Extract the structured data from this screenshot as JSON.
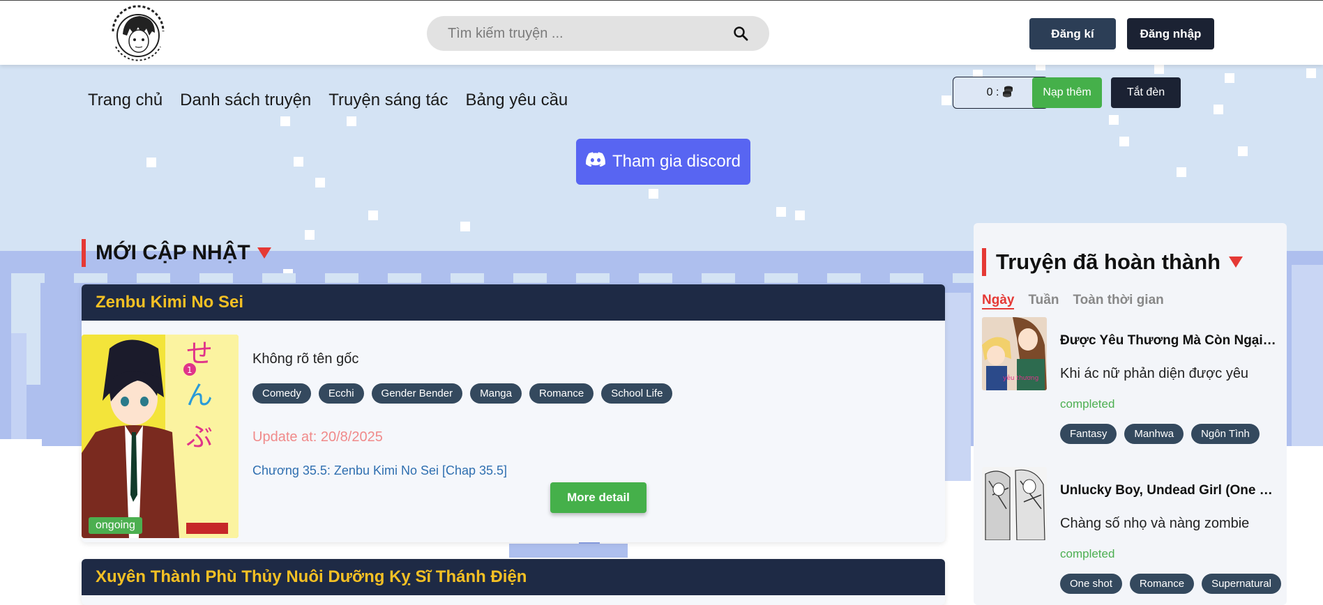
{
  "header": {
    "logo_text": "LIVESTRA COMICS - FOUNDATION OF STORYTELLING",
    "search_placeholder": "Tìm kiếm truyện ...",
    "register_label": "Đăng kí",
    "login_label": "Đăng nhập"
  },
  "nav": {
    "items": [
      "Trang chủ",
      "Danh sách truyện",
      "Truyện sáng tác",
      "Bảng yêu cầu"
    ],
    "coin_label": "0 :",
    "topup_label": "Nạp thêm",
    "lights_label": "Tắt đèn"
  },
  "discord": {
    "label": "Tham gia discord"
  },
  "main": {
    "section_title": "MỚI CẬP NHẬT",
    "comics": [
      {
        "title": "Zenbu Kimi No Sei",
        "original_name": "Không rõ tên gốc",
        "tags": [
          "Comedy",
          "Ecchi",
          "Gender Bender",
          "Manga",
          "Romance",
          "School Life"
        ],
        "updated": "Update at: 20/8/2025",
        "chapter": "Chương 35.5: Zenbu Kimi No Sei [Chap 35.5]",
        "status": "ongoing",
        "more_label": "More detail"
      },
      {
        "title": "Xuyên Thành Phù Thủy Nuôi Dưỡng Kỵ Sĩ Thánh Điện"
      }
    ]
  },
  "sidebar": {
    "title": "Truyện đã hoàn thành",
    "tabs": [
      "Ngày",
      "Tuần",
      "Toàn thời gian"
    ],
    "items": [
      {
        "title": "Được Yêu Thương Mà Còn Ngại Ngùng Sao",
        "desc": "Khi ác nữ phản diện được yêu",
        "status": "completed",
        "tags": [
          "Fantasy",
          "Manhwa",
          "Ngôn Tình"
        ]
      },
      {
        "title": "Unlucky Boy, Undead Girl (One Shot)",
        "desc": "Chàng số nhọ và nàng zombie",
        "status": "completed",
        "tags": [
          "One shot",
          "Romance",
          "Supernatural"
        ]
      }
    ]
  },
  "colors": {
    "accent_red": "#e53935",
    "navy": "#1e2a45",
    "gold": "#f4c024",
    "green": "#4caf50",
    "discord": "#5865f2"
  }
}
